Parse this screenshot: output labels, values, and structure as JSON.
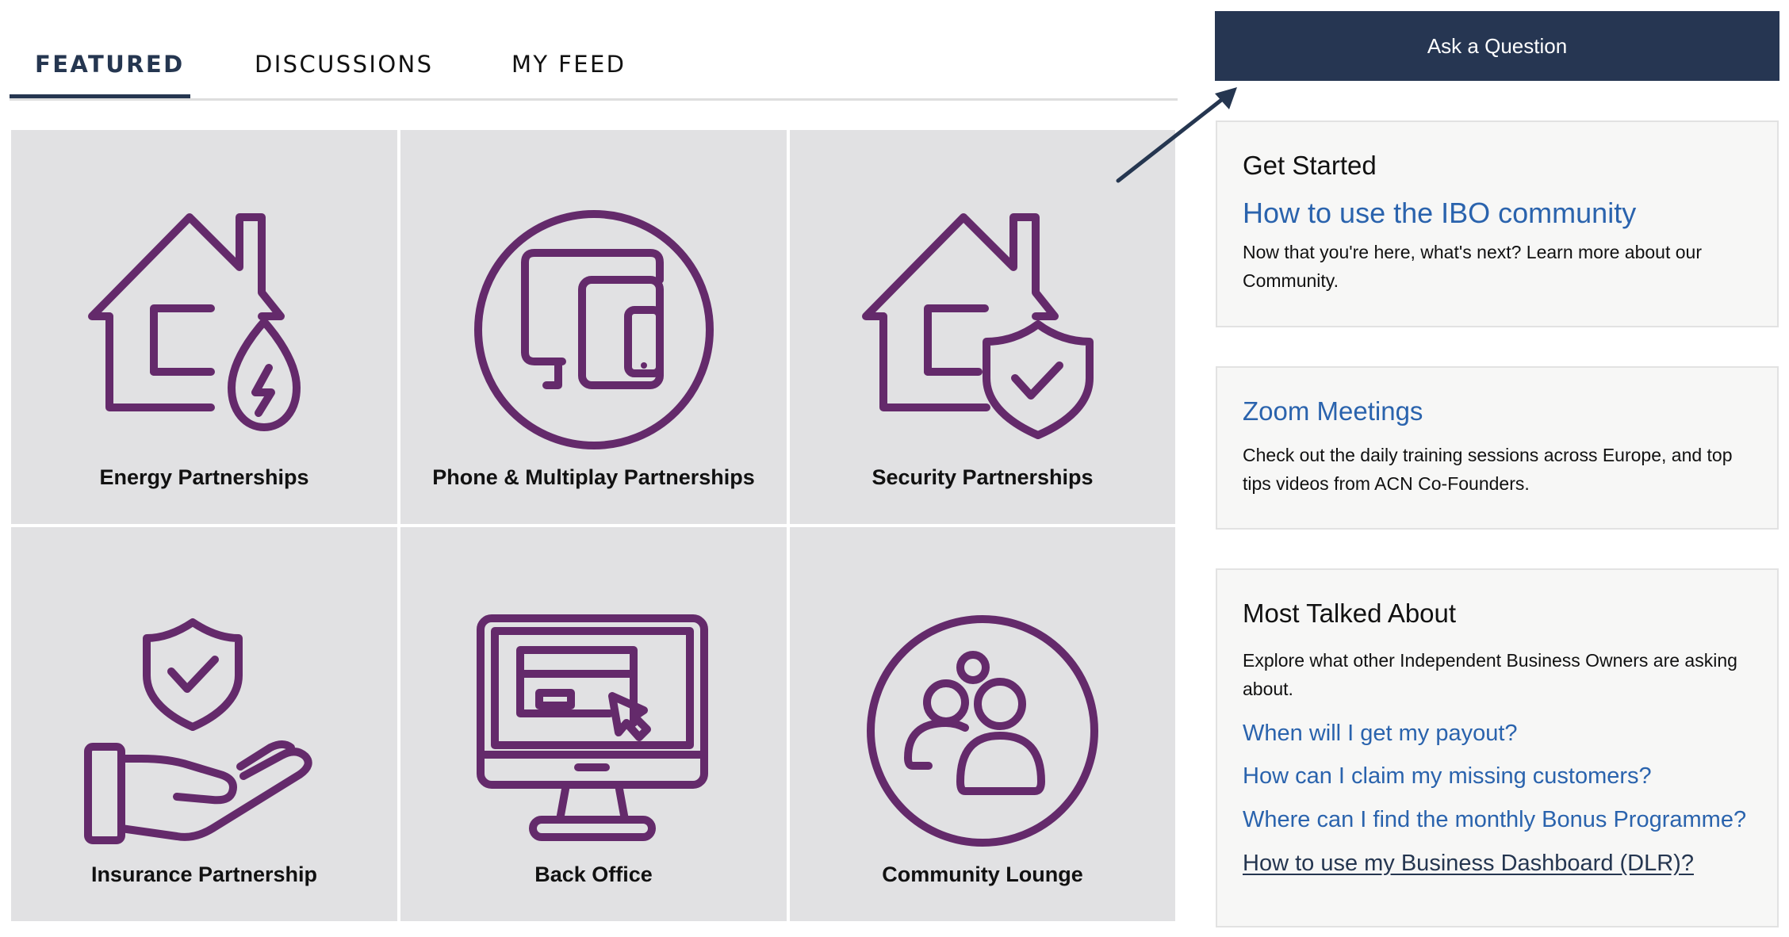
{
  "tabs": [
    {
      "label": "FEATURED",
      "active": true
    },
    {
      "label": "DISCUSSIONS",
      "active": false
    },
    {
      "label": "MY FEED",
      "active": false
    }
  ],
  "tiles": [
    {
      "label": "Energy Partnerships",
      "icon": "house-energy-icon"
    },
    {
      "label": "Phone & Multiplay Partnerships",
      "icon": "devices-icon"
    },
    {
      "label": "Security Partnerships",
      "icon": "house-shield-icon"
    },
    {
      "label": "Insurance Partnership",
      "icon": "hand-shield-icon"
    },
    {
      "label": "Back Office",
      "icon": "monitor-icon"
    },
    {
      "label": "Community Lounge",
      "icon": "community-icon"
    }
  ],
  "sidebar": {
    "ask_button": "Ask a Question",
    "get_started": {
      "title": "Get Started",
      "link": "How to use the IBO community",
      "text": "Now that you're here, what's next? Learn more about our Community."
    },
    "zoom": {
      "link": "Zoom Meetings",
      "text": "Check out the daily training sessions across Europe, and top tips videos from ACN Co-Founders."
    },
    "most_talked": {
      "title": "Most Talked About",
      "text": "Explore what other Independent Business Owners are asking about.",
      "links": [
        "When will I get my payout?",
        "How can I claim my missing customers?",
        "Where can I find the monthly Bonus Programme?",
        "How to use my Business Dashboard (DLR)?"
      ]
    }
  },
  "colors": {
    "navy": "#263652",
    "icon_purple": "#642a6b",
    "link_blue": "#2a63ad",
    "tile_bg": "#e1e1e3",
    "card_bg": "#f7f7f6"
  }
}
